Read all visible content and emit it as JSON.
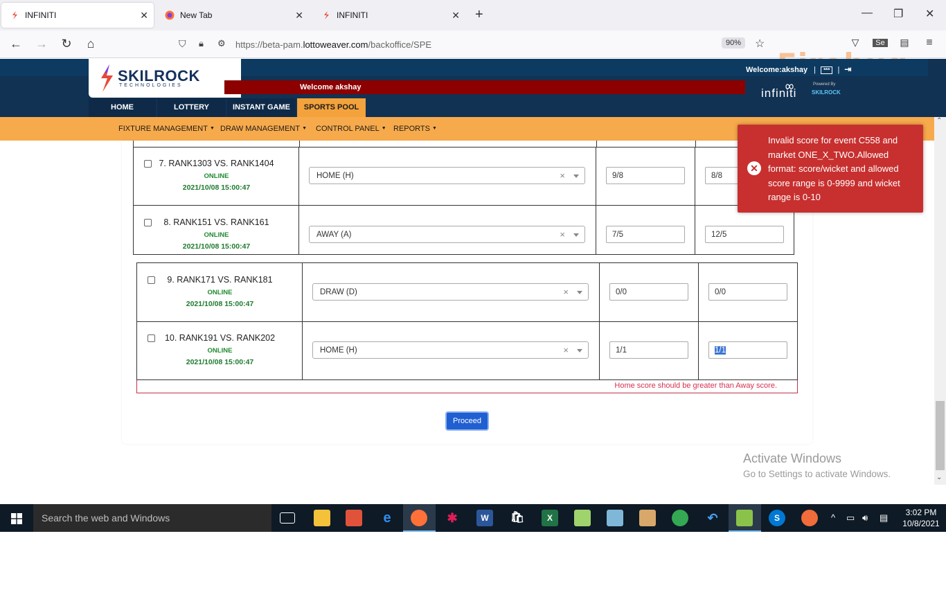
{
  "browser": {
    "tabs": [
      {
        "label": "INFINITI",
        "active": true
      },
      {
        "label": "New Tab",
        "active": false
      },
      {
        "label": "INFINITI",
        "active": false
      }
    ],
    "url_prefix": "https://beta-pam.",
    "url_domain": "lottoweaver.com",
    "url_path": "/backoffice/SPE",
    "zoom": "90%",
    "firebug_label": "Firebug"
  },
  "header": {
    "logo_text": "SKILROCK",
    "logo_sub": "TECHNOLOGIES",
    "welcome_user": "Welcome:akshay",
    "welcome_banner": "Welcome akshay",
    "brand": "infiniti",
    "powered_by": "Powered By",
    "powered_brand": "SKILROCK"
  },
  "main_nav": [
    "HOME",
    "LOTTERY",
    "INSTANT GAME",
    "SPORTS POOL"
  ],
  "main_nav_active": "SPORTS POOL",
  "sub_nav": [
    "FIXTURE MANAGEMENT",
    "DRAW MANAGEMENT",
    "CONTROL PANEL",
    "REPORTS"
  ],
  "matches": [
    {
      "title": "7. RANK1303 VS. RANK1404",
      "status": "ONLINE",
      "date": "2021/10/08 15:00:47",
      "result": "HOME (H)",
      "home_score": "9/8",
      "away_score": "8/8"
    },
    {
      "title": "8. RANK151 VS. RANK161",
      "status": "ONLINE",
      "date": "2021/10/08 15:00:47",
      "result": "AWAY (A)",
      "home_score": "7/5",
      "away_score": "12/5"
    },
    {
      "title": "9. RANK171 VS. RANK181",
      "status": "ONLINE",
      "date": "2021/10/08 15:00:47",
      "result": "DRAW (D)",
      "home_score": "0/0",
      "away_score": "0/0"
    },
    {
      "title": "10. RANK191 VS. RANK202",
      "status": "ONLINE",
      "date": "2021/10/08 15:00:47",
      "result": "HOME (H)",
      "home_score": "1/1",
      "away_score": "1/1"
    }
  ],
  "error_message": "Home score should be greater than Away score.",
  "proceed_label": "Proceed",
  "toast": {
    "message": "Invalid score for event C558 and market ONE_X_TWO.Allowed format: score/wicket and allowed score range is 0-9999 and wicket range is 0-10",
    "color": "#c7302f"
  },
  "watermark": {
    "title": "Activate Windows",
    "subtitle": "Go to Settings to activate Windows."
  },
  "taskbar": {
    "search_placeholder": "Search the web and Windows",
    "time": "3:02 PM",
    "date": "10/8/2021"
  }
}
